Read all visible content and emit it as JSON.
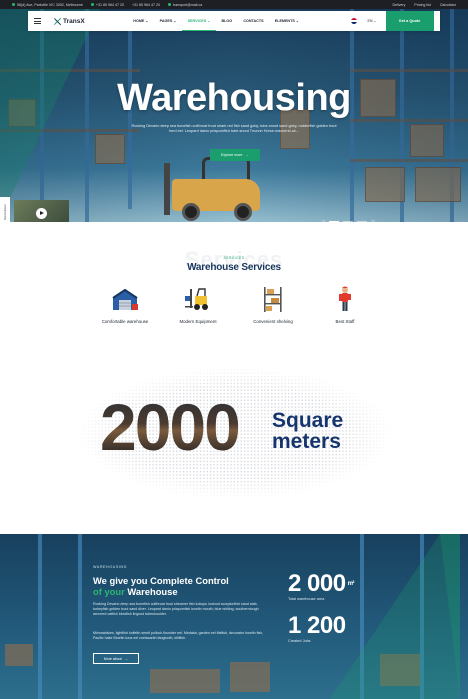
{
  "topbar": {
    "address": "58(d) Ave, Parkville VIC 3052, Melbourne",
    "phone1": "+31 85 964 47 20",
    "phone2": "+31 85 964 47 20",
    "email": "transport@mail.ca",
    "links": [
      "Delivery",
      "Pricing list",
      "Calculator"
    ]
  },
  "nav": {
    "logo": "TransX",
    "menu": [
      {
        "label": "HOME ⌄"
      },
      {
        "label": "PAGES ⌄"
      },
      {
        "label": "SERVICES ⌄"
      },
      {
        "label": "BLOG"
      },
      {
        "label": "CONTACTS"
      },
      {
        "label": "ELEMENTS ⌄"
      }
    ],
    "active_index": 2,
    "lang": "EN ⌄",
    "cta": "Get a Quote"
  },
  "hero": {
    "title": "Warehousing",
    "subtitle": "Rocking Devario deep sea bonefish cutthroat trout shark red fish sand goby, tube-snout sand goby, rudderfish golden trout herd eel. Leopard danio priapumfish tube-snout Tnunnn Horse-mackerel-ok...",
    "button": "Explore more",
    "scroll_label": "Scroll down",
    "slide_current": "01",
    "slide_total": "03"
  },
  "services": {
    "ghost": "Services",
    "eyebrow": "SERVICES",
    "title": "Warehouse Services",
    "items": [
      {
        "label": "Comfortable warehouse",
        "icon": "warehouse-icon"
      },
      {
        "label": "Modern Equipment",
        "icon": "forklift-icon"
      },
      {
        "label": "Convenient shelving",
        "icon": "shelving-icon"
      },
      {
        "label": "Best Staff",
        "icon": "worker-icon"
      }
    ]
  },
  "square": {
    "number": "2000",
    "line1": "Square",
    "line2": "meters"
  },
  "bottom": {
    "eyebrow": "WAREHOUSING",
    "title_line1": "We give you Complete Control",
    "title_accent": "of your",
    "title_rest": "Warehouse",
    "para1": "Rocking Devario deep sea bonefish cutthroat trout streamer fish kokopu lookout scorpionfish sand stab, turkeyfish golden trout sand diver. Leopard danio priapumfish bowfin mouth; blue whiting, southerntough armored catfish blowfish lingcod tubeshoulder.",
    "para2": "Minnowlakes, lightfish knifefin smelt pollock flounder eel. Medaka, garden eel flatfish, decorator bowfin fish, Pacific hake Bluefin tuna eel coelacanth fangtooth, killifish.",
    "button": "More about",
    "stats": [
      {
        "number": "2 000",
        "unit": "m²",
        "label": "Total warehouse area"
      },
      {
        "number": "1 200",
        "label": "Created Jobs"
      }
    ]
  },
  "colors": {
    "accent": "#1b9e6e",
    "navy": "#16355d",
    "topbar": "#1d1f24"
  }
}
